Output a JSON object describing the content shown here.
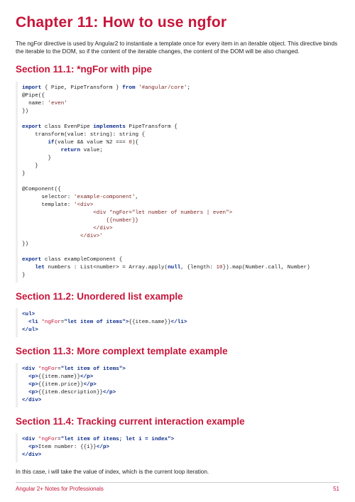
{
  "chapter_title": "Chapter 11: How to use ngfor",
  "intro_text": "The ngFor directive is used by Angular2 to instantiate a template once for every item in an iterable object. This directive binds the iterable to the DOM, so if the content of the iterable changes, the content of the DOM will be also changed.",
  "sections": {
    "s1": {
      "title": "Section 11.1: *ngFor with pipe"
    },
    "s2": {
      "title": "Section 11.2: Unordered list example"
    },
    "s3": {
      "title": "Section 11.3: More complext template example"
    },
    "s4": {
      "title": "Section 11.4: Tracking current interaction example"
    }
  },
  "code1": {
    "l1_a": "import",
    "l1_b": " { Pipe, PipeTransform } ",
    "l1_c": "from",
    "l1_d": " '#angular/core'",
    "l1_e": ";",
    "l2_a": "@Pipe",
    "l2_b": "({",
    "l3_a": "  name: ",
    "l3_b": "'even'",
    "l4": "})",
    "l5": "",
    "l6_a": "export",
    "l6_b": " class EvenPipe ",
    "l6_c": "implements",
    "l6_d": " PipeTransform {",
    "l7_a": "    transform(value: string): string {",
    "l8_a": "        if",
    "l8_b": "(value && value %2 === ",
    "l8_c": "0",
    "l8_d": "){",
    "l9_a": "            return",
    "l9_b": " value;",
    "l10": "        }",
    "l11": "    }",
    "l12": "}",
    "l13": "",
    "l14_a": "@Component",
    "l14_b": "({",
    "l15_a": "      selector: ",
    "l15_b": "'example-component'",
    "l15_c": ",",
    "l16_a": "      template: ",
    "l16_b": "'<div>",
    "l17": "                      <div *ngFor=\"let number of numbers | even\">",
    "l18": "                          {{number}}",
    "l19": "                      </div>",
    "l20": "                  </div>'",
    "l21": "})",
    "l22": "",
    "l23_a": "export",
    "l23_b": " class exampleComponent {",
    "l24_a": "    let",
    "l24_b": " numbers : List<number> = ",
    "l24_c": "Array",
    "l24_d": ".apply(",
    "l24_e": "null",
    "l24_f": ", {length: ",
    "l24_g": "10",
    "l24_h": "}).map(Number.call, Number)",
    "l25": "}"
  },
  "code2": {
    "l1_a": "<ul>",
    "l2_a": "  <li ",
    "l2_b": "*ngFor",
    "l2_c": "=",
    "l2_d": "\"let item of items\"",
    "l2_e": ">",
    "l2_f": "{{item.name}}",
    "l2_g": "</li>",
    "l3_a": "</ul>"
  },
  "code3": {
    "l1_a": "<div ",
    "l1_b": "*ngFor",
    "l1_c": "=",
    "l1_d": "\"let item of items\"",
    "l1_e": ">",
    "l2_a": "  <p>",
    "l2_b": "{{item.name}}",
    "l2_c": "</p>",
    "l3_a": "  <p>",
    "l3_b": "{{item.price}}",
    "l3_c": "</p>",
    "l4_a": "  <p>",
    "l4_b": "{{item.description}}",
    "l4_c": "</p>",
    "l5_a": "</div>"
  },
  "code4": {
    "l1_a": "<div ",
    "l1_b": "*ngFor",
    "l1_c": "=",
    "l1_d": "\"let item of items; let i = index\"",
    "l1_e": ">",
    "l2_a": "  <p>",
    "l2_b": "Item number: {{i}}",
    "l2_c": "</p>",
    "l3_a": "</div>"
  },
  "outro_text": "In this case, i will take the value of index, which is the current loop iteration.",
  "footer": {
    "left": "Angular 2+ Notes for Professionals",
    "right": "51"
  }
}
